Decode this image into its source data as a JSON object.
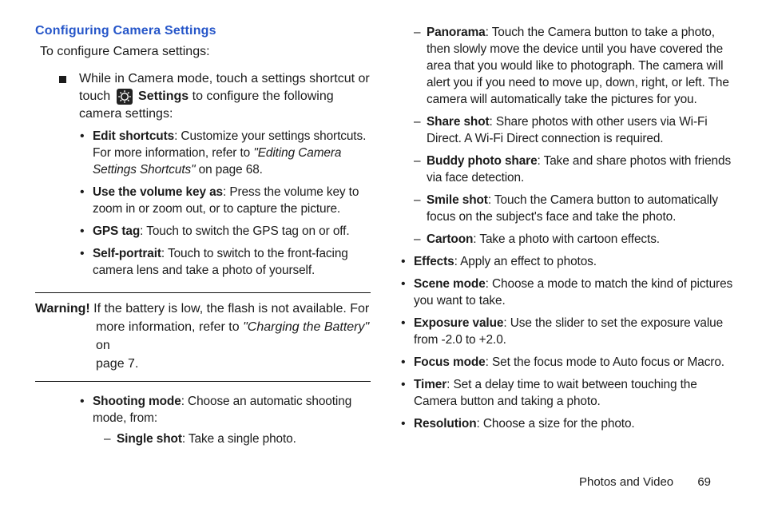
{
  "heading": "Configuring Camera Settings",
  "intro": "To configure Camera settings:",
  "square": {
    "pre": "While in Camera mode, touch a settings shortcut or touch ",
    "settings_word": "Settings",
    "post": " to configure the following camera settings:"
  },
  "left_b1": [
    {
      "bold": "Edit shortcuts",
      "rest": ": Customize your settings shortcuts. For more information, refer to ",
      "ital": "\"Editing Camera Settings Shortcuts\"",
      "tail": " on page 68."
    },
    {
      "bold": "Use the volume key as",
      "rest": ": Press the volume key to zoom in or zoom out, or to capture the picture."
    },
    {
      "bold": "GPS tag",
      "rest": ": Touch to switch the GPS tag on or off."
    },
    {
      "bold": "Self-portrait",
      "rest": ": Touch to switch to the front-facing camera lens and take a photo of yourself."
    }
  ],
  "warning": {
    "label": "Warning!",
    "line1": " If the battery is low, the flash is not available. For",
    "line2": "more information, refer to ",
    "ital": "\"Charging the Battery\"",
    "line3": " on",
    "line4": "page 7."
  },
  "left_b2": {
    "bold": "Shooting mode",
    "rest": ": Choose an automatic shooting mode, from:"
  },
  "left_d_single": {
    "bold": "Single shot",
    "rest": ": Take a single photo."
  },
  "right_d": [
    {
      "bold": "Panorama",
      "rest": ": Touch the Camera button to take a photo, then slowly move the device until you have covered the area that you would like to photograph. The camera will alert you if you need to move up, down, right, or left. The camera will automatically take the pictures for you."
    },
    {
      "bold": "Share shot",
      "rest": ": Share photos with other users via Wi-Fi Direct. A Wi-Fi Direct connection is required."
    },
    {
      "bold": "Buddy photo share",
      "rest": ": Take and share photos with friends via face detection."
    },
    {
      "bold": "Smile shot",
      "rest": ": Touch the Camera button to automatically focus on the subject's face and take the photo."
    },
    {
      "bold": "Cartoon",
      "rest": ": Take a photo with cartoon effects."
    }
  ],
  "right_b": [
    {
      "bold": "Effects",
      "rest": ": Apply an effect to photos."
    },
    {
      "bold": "Scene mode",
      "rest": ": Choose a mode to match the kind of pictures you want to take."
    },
    {
      "bold": "Exposure value",
      "rest": ": Use the slider to set the exposure value from -2.0 to +2.0."
    },
    {
      "bold": "Focus mode",
      "rest": ": Set the focus mode to Auto focus or Macro."
    },
    {
      "bold": "Timer",
      "rest": ": Set a delay time to wait between touching the Camera button and taking a photo."
    },
    {
      "bold": "Resolution",
      "rest": ": Choose a size for the photo."
    }
  ],
  "footer": {
    "section": "Photos and Video",
    "page": "69"
  }
}
